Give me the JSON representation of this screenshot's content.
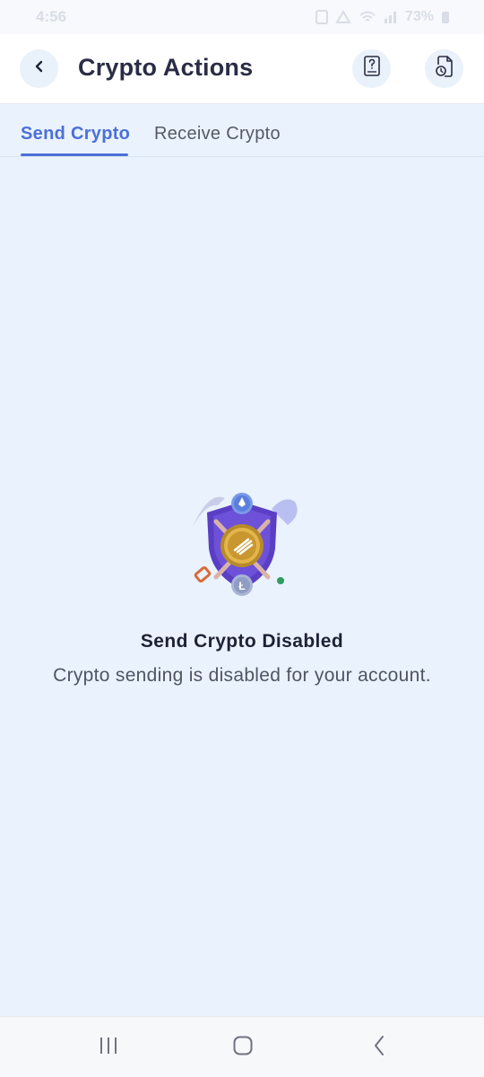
{
  "status_bar": {
    "time": "4:56",
    "battery": "73%"
  },
  "header": {
    "title": "Crypto Actions",
    "back_icon": "chevron-left-icon",
    "help_icon": "help-document-icon",
    "history_icon": "history-document-icon"
  },
  "tabs": [
    {
      "label": "Send Crypto",
      "active": true
    },
    {
      "label": "Receive Crypto",
      "active": false
    }
  ],
  "empty_state": {
    "illustration": "mining-shield-illustration",
    "title": "Send Crypto Disabled",
    "message": "Crypto sending is disabled for your account."
  },
  "nav_bar": {
    "icons": [
      "recents-icon",
      "home-icon",
      "back-icon"
    ]
  },
  "colors": {
    "accent": "#4b70d8",
    "background": "#eaf2fd",
    "header_bg": "#ffffff",
    "icon_button_bg": "#e9f1fb"
  }
}
